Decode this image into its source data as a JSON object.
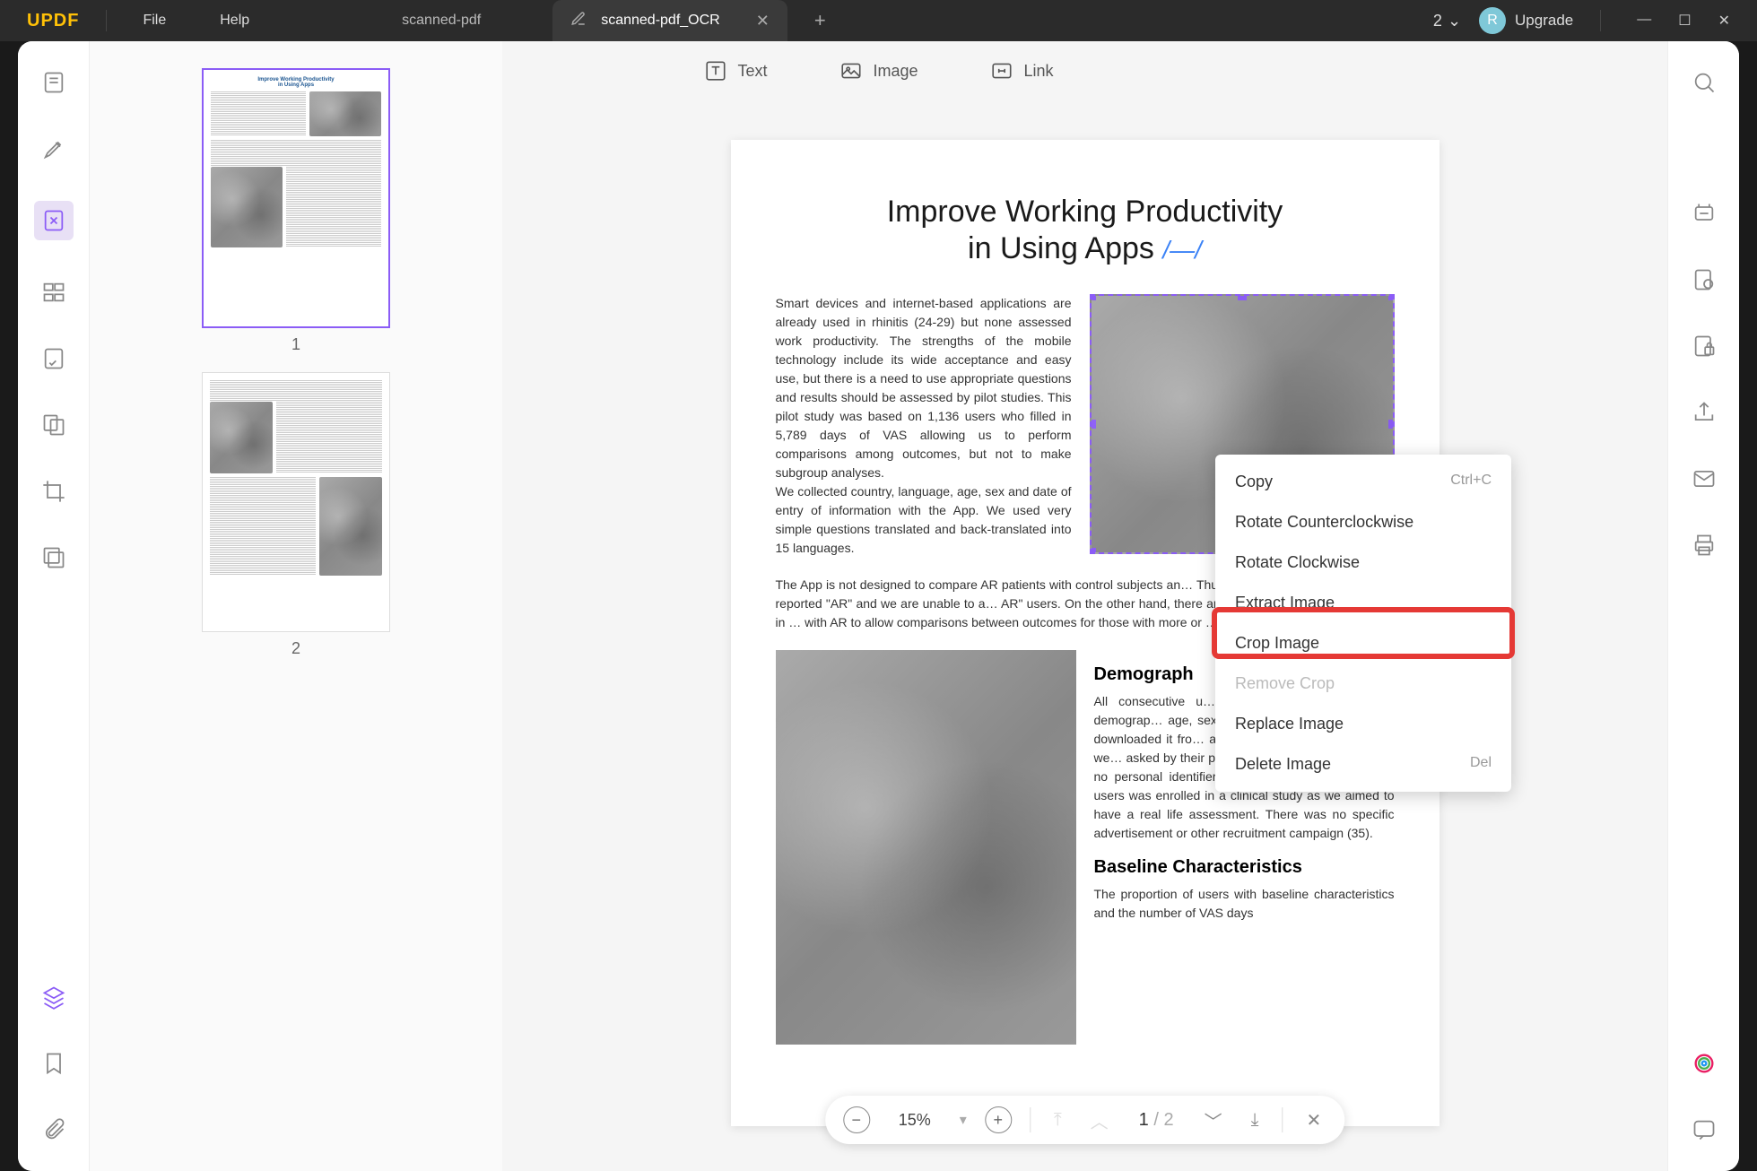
{
  "app": {
    "name": "UPDF"
  },
  "menu": {
    "file": "File",
    "help": "Help"
  },
  "tabs": {
    "inactive": "scanned-pdf",
    "active": "scanned-pdf_OCR",
    "count": "2"
  },
  "upgrade": {
    "label": "Upgrade",
    "avatar_letter": "R"
  },
  "edit_toolbar": {
    "text": "Text",
    "image": "Image",
    "link": "Link"
  },
  "thumbnails": {
    "page1": "1",
    "page2": "2"
  },
  "document": {
    "title_line1": "Improve Working Productivity",
    "title_line2": "in Using Apps",
    "title_accent": "/—/",
    "para1": "Smart devices and internet-based applications are already used in rhinitis (24-29) but none assessed work productivity. The strengths of the mobile technology include its wide acceptance and easy use, but there is a need to use appropriate questions and results should be assessed by pilot studies. This pilot study was based on 1,136 users who filled in 5,789 days of VAS allowing us to perform comparisons among outcomes, but not to make subgroup analyses.",
    "para2": "We collected country, language, age, sex and date of entry of information with the App. We used very simple questions translated and back-translated into 15 languages.",
    "para3_part": "The App is not designed to compare AR patients with control subjects an… Thus, as expected, over 98% users reported \"AR\" and we are unable to a… AR\" users. On the other hand, there are many days with no symptoms in … with AR to allow comparisons between outcomes for those with more or …",
    "heading1_part": "Demograph",
    "para4_part": "All consecutive u… October 31, 2016… Some demograp… age, sex, country … The Allergy Diar… downloaded it fro… and other internet… A few users we… asked by their pl… Due to anonymiza… of data, no personal identifiers were gathered. None of the users was enrolled in a clinical study as we aimed to have a real life assessment. There was no specific advertisement or other recruitment campaign (35).",
    "heading2": "Baseline Characteristics",
    "para5": "The proportion of users with baseline characteristics and the number of VAS days"
  },
  "context_menu": {
    "copy": "Copy",
    "copy_shortcut": "Ctrl+C",
    "rotate_ccw": "Rotate Counterclockwise",
    "rotate_cw": "Rotate Clockwise",
    "extract": "Extract Image",
    "crop": "Crop Image",
    "remove_crop": "Remove Crop",
    "replace": "Replace Image",
    "delete": "Delete Image",
    "delete_shortcut": "Del"
  },
  "zoom": {
    "value": "15%",
    "page_current": "1",
    "page_sep": "/",
    "page_total": "2"
  }
}
